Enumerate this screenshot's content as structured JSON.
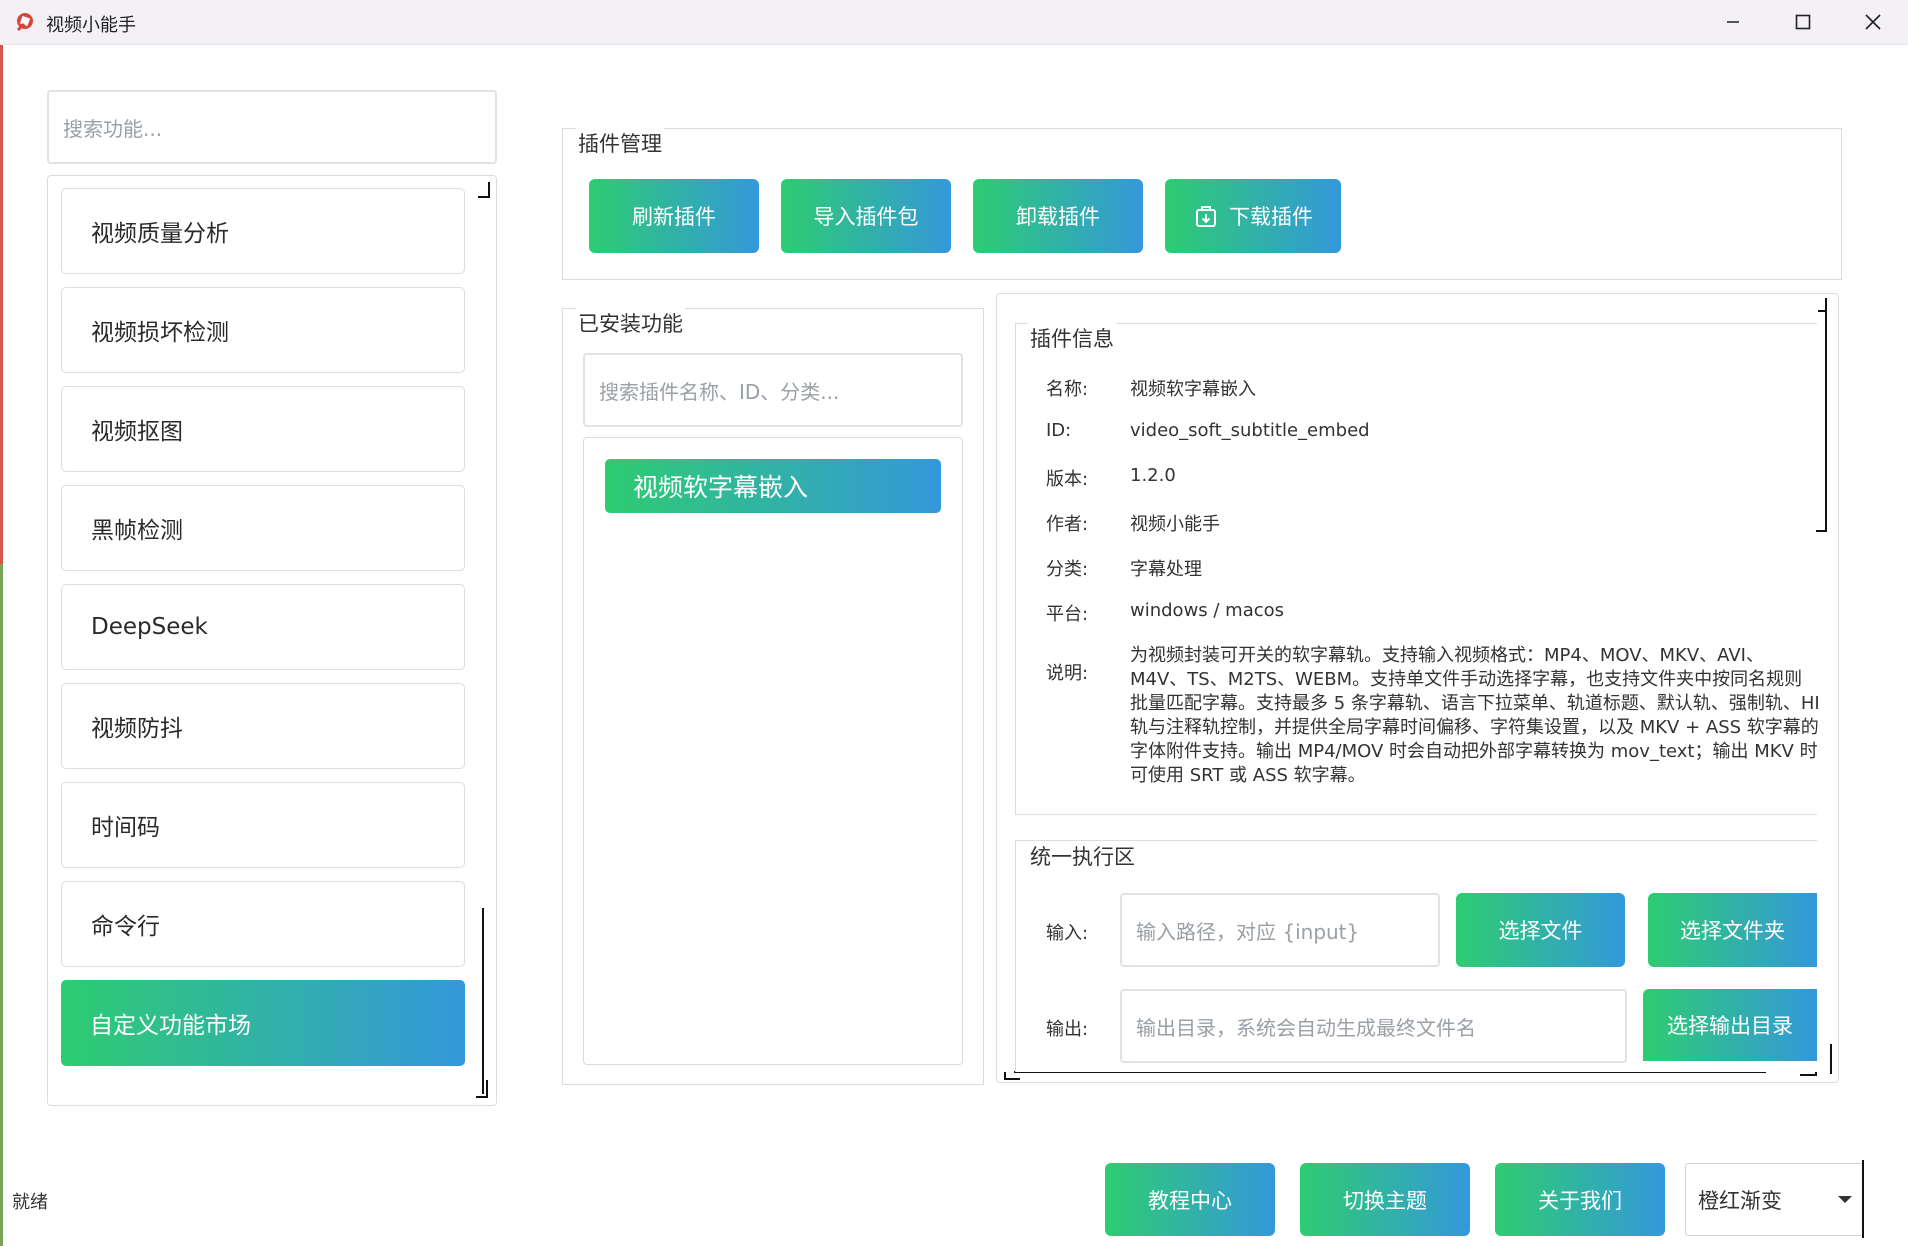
{
  "window": {
    "title": "视频小能手",
    "minimize_icon": "minimize-icon",
    "maximize_icon": "maximize-icon",
    "close_icon": "close-icon"
  },
  "sidebar": {
    "search_placeholder": "搜索功能...",
    "items": [
      {
        "label": "视频质量分析",
        "active": false
      },
      {
        "label": "视频损坏检测",
        "active": false
      },
      {
        "label": "视频抠图",
        "active": false
      },
      {
        "label": "黑帧检测",
        "active": false
      },
      {
        "label": "DeepSeek",
        "active": false
      },
      {
        "label": "视频防抖",
        "active": false
      },
      {
        "label": "时间码",
        "active": false
      },
      {
        "label": "命令行",
        "active": false
      },
      {
        "label": "自定义功能市场",
        "active": true
      }
    ]
  },
  "plugin_management": {
    "title": "插件管理",
    "buttons": {
      "refresh": "刷新插件",
      "import": "导入插件包",
      "uninstall": "卸载插件",
      "download": "下载插件"
    },
    "download_icon": "package-download-icon"
  },
  "installed": {
    "title": "已安装功能",
    "search_placeholder": "搜索插件名称、ID、分类...",
    "items": [
      "视频软字幕嵌入"
    ]
  },
  "plugin_info": {
    "title": "插件信息",
    "fields": [
      {
        "label": "名称:",
        "value": "视频软字幕嵌入"
      },
      {
        "label": "ID:",
        "value": "video_soft_subtitle_embed"
      },
      {
        "label": "版本:",
        "value": "1.2.0"
      },
      {
        "label": "作者:",
        "value": "视频小能手"
      },
      {
        "label": "分类:",
        "value": "字幕处理"
      },
      {
        "label": "平台:",
        "value": "windows / macos"
      }
    ],
    "description_label": "说明:",
    "description": "为视频封装可开关的软字幕轨。支持输入视频格式：MP4、MOV、MKV、AVI、\nM4V、TS、M2TS、WEBM。支持单文件手动选择字幕，也支持文件夹中按同名规则\n批量匹配字幕。支持最多 5 条字幕轨、语言下拉菜单、轨道标题、默认轨、强制轨、HI\n轨与注释轨控制，并提供全局字幕时间偏移、字符集设置，以及 MKV + ASS 软字幕的\n字体附件支持。输出 MP4/MOV 时会自动把外部字幕转换为 mov_text；输出 MKV 时\n可使用 SRT 或 ASS 软字幕。"
  },
  "execution": {
    "title": "统一执行区",
    "input_label": "输入:",
    "input_placeholder": "输入路径，对应 {input}",
    "select_file": "选择文件",
    "select_folder": "选择文件夹",
    "output_label": "输出:",
    "output_placeholder": "输出目录，系统会自动生成最终文件名",
    "select_output_dir": "选择输出目录"
  },
  "footer": {
    "status": "就绪",
    "tutorial": "教程中心",
    "switch_theme": "切换主题",
    "about": "关于我们",
    "theme_selected": "橙红渐变"
  }
}
